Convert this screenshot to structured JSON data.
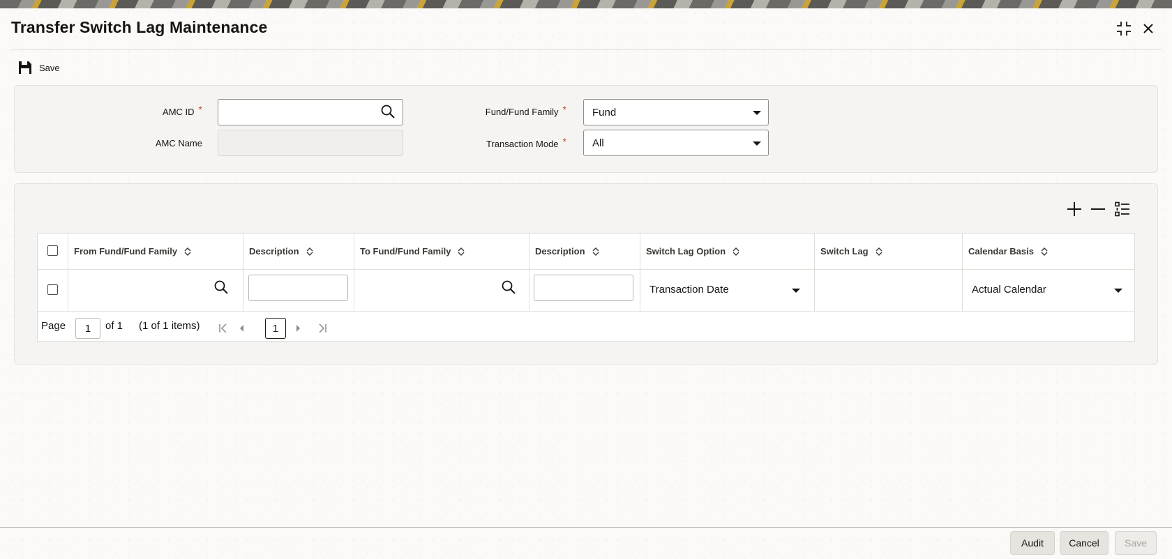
{
  "window": {
    "title": "Transfer Switch Lag Maintenance",
    "maximize_icon": "collapse-arrows-icon",
    "close_icon": "close-icon"
  },
  "toolbar": {
    "save_label": "Save",
    "save_icon": "floppy-disk-icon"
  },
  "form": {
    "amc_id": {
      "label": "AMC ID",
      "required_mark": "*",
      "value": ""
    },
    "amc_name": {
      "label": "AMC Name",
      "value": ""
    },
    "fund_family": {
      "label": "Fund/Fund Family",
      "required_mark": "*",
      "value": "Fund"
    },
    "transaction_mode": {
      "label": "Transaction Mode",
      "required_mark": "*",
      "value": "All"
    }
  },
  "grid": {
    "tools": {
      "add_icon": "plus-icon",
      "remove_icon": "minus-icon",
      "columns_icon": "list-settings-icon"
    },
    "columns": [
      "From Fund/Fund Family",
      "Description",
      "To Fund/Fund Family",
      "Description",
      "Switch Lag Option",
      "Switch Lag",
      "Calendar Basis"
    ],
    "row": {
      "from_fund": "",
      "from_description": "",
      "to_fund": "",
      "to_description": "",
      "switch_lag_option": "Transaction Date",
      "switch_lag": "",
      "calendar_basis": "Actual Calendar"
    },
    "pager": {
      "page_label": "Page",
      "page_value": "1",
      "of_label": "of 1",
      "items_label": "(1 of 1 items)",
      "current_page": "1"
    }
  },
  "footer": {
    "audit_label": "Audit",
    "cancel_label": "Cancel",
    "save_label": "Save"
  }
}
